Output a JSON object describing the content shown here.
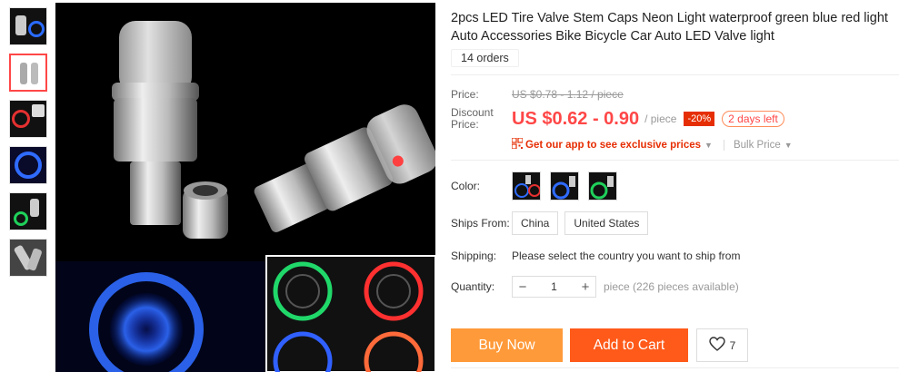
{
  "product": {
    "title": "2pcs LED Tire Valve Stem Caps Neon Light waterproof green blue red light Auto Accessories Bike Bicycle Car Auto LED Valve light",
    "orders": "14 orders"
  },
  "pricing": {
    "price_label": "Price:",
    "original_price": "US $0.78 - 1.12 / piece",
    "discount_label": "Discount Price:",
    "discount_price": "US $0.62 - 0.90",
    "per_piece": "/ piece",
    "discount_pct": "-20%",
    "days_left": "2 days left",
    "app_promo": "Get our app to see exclusive prices",
    "bulk_price": "Bulk Price"
  },
  "options": {
    "color_label": "Color:",
    "ships_from_label": "Ships From:",
    "ships_from": [
      "China",
      "United States"
    ],
    "shipping_label": "Shipping:",
    "shipping_text": "Please select the country you want to ship from",
    "quantity_label": "Quantity:",
    "quantity_value": "1",
    "quantity_minus": "−",
    "quantity_plus": "+",
    "availability": "piece (226 pieces available)"
  },
  "actions": {
    "buy_now": "Buy Now",
    "add_to_cart": "Add to Cart",
    "wishlist_count": "7"
  },
  "icons": {
    "qr": "qr-code-icon",
    "heart": "heart-icon",
    "caret": "caret-down-icon"
  },
  "colors": {
    "accent_red": "#ff4747",
    "buy_now_bg": "#ff9a3a",
    "add_to_cart_bg": "#ff5a1a"
  }
}
